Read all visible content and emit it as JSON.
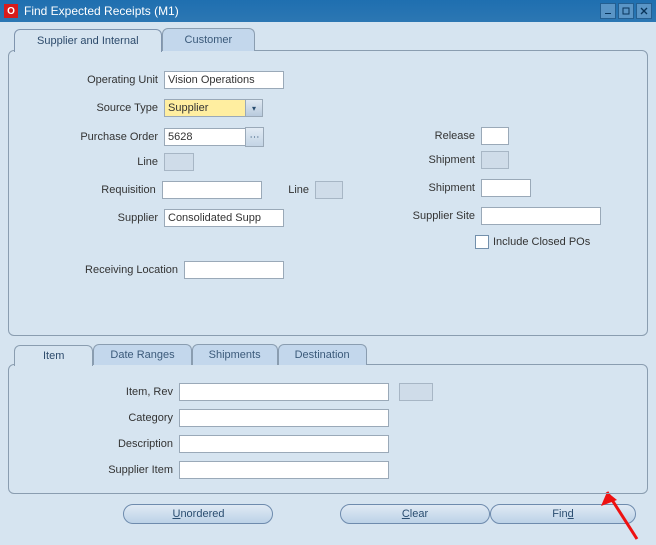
{
  "window": {
    "title": "Find Expected Receipts (M1)"
  },
  "tabs_top": {
    "supplier_internal": "Supplier and Internal",
    "customer": "Customer"
  },
  "form": {
    "operating_unit_label": "Operating Unit",
    "operating_unit_value": "Vision Operations",
    "source_type_label": "Source Type",
    "source_type_value": "Supplier",
    "purchase_order_label": "Purchase Order",
    "purchase_order_value": "5628",
    "line_label": "Line",
    "line_value": "",
    "requisition_label": "Requisition",
    "requisition_value": "",
    "req_line_label": "Line",
    "req_line_value": "",
    "supplier_label": "Supplier",
    "supplier_value": "Consolidated Supp",
    "receiving_location_label": "Receiving Location",
    "receiving_location_value": "",
    "release_label": "Release",
    "release_value": "",
    "shipment_label": "Shipment",
    "shipment_value": "",
    "shipment2_label": "Shipment",
    "shipment2_value": "",
    "supplier_site_label": "Supplier Site",
    "supplier_site_value": "",
    "include_closed_label": "Include Closed POs"
  },
  "tabs_lower": {
    "item": "Item",
    "date_ranges": "Date Ranges",
    "shipments": "Shipments",
    "destination": "Destination"
  },
  "item_panel": {
    "item_rev_label": "Item, Rev",
    "item_rev_value": "",
    "item_rev_value2": "",
    "category_label": "Category",
    "category_value": "",
    "description_label": "Description",
    "description_value": "",
    "supplier_item_label": "Supplier Item",
    "supplier_item_value": ""
  },
  "buttons": {
    "unordered": "nordered",
    "unordered_mn": "U",
    "clear": "lear",
    "clear_mn": "C",
    "find": "Fin",
    "find_mn": "d"
  }
}
